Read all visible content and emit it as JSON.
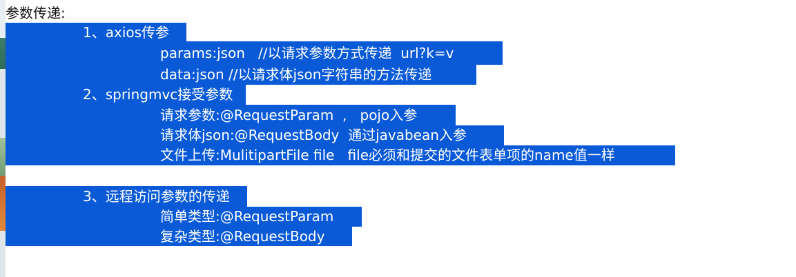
{
  "heading": "参数传递:",
  "lines": {
    "axios_title": "1、axios传参",
    "axios_params": "params:json   //以请求参数方式传递  url?k=v",
    "axios_data": "data:json //以请求体json字符串的方法传递",
    "springmvc_title": "2、springmvc接受参数",
    "request_param": "请求参数:@RequestParam  ,   pojo入参",
    "request_body": "请求体json:@RequestBody  通过javabean入参",
    "file_upload": "文件上传:MulitipartFile file   file必须和提交的文件表单项的name值一样",
    "remote_title": "3、远程访问参数的传递",
    "simple_type": "简单类型:@RequestParam",
    "complex_type": "复杂类型:@RequestBody"
  },
  "colors": {
    "selection": "#0a5ad8",
    "selected_text": "#ffffff",
    "heading_text": "#111111"
  }
}
